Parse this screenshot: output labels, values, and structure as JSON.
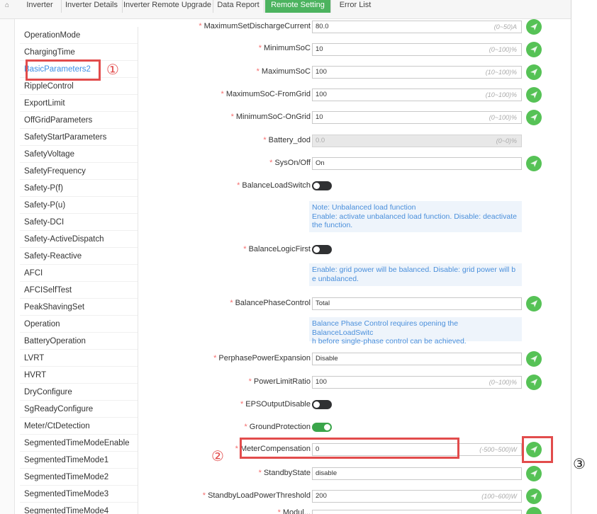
{
  "tabs": [
    "Inverter",
    "Inverter Details",
    "Inverter Remote Upgrade",
    "Data Report",
    "Remote Setting",
    "Error List"
  ],
  "sidebar": {
    "items": [
      "OperationMode",
      "ChargingTime",
      "BasicParameters2",
      "RippleControl",
      "ExportLimit",
      "OffGridParameters",
      "SafetyStartParameters",
      "SafetyVoltage",
      "SafetyFrequency",
      "Safety-P(f)",
      "Safety-P(u)",
      "Safety-DCI",
      "Safety-ActiveDispatch",
      "Safety-Reactive",
      "AFCI",
      "AFCISelfTest",
      "PeakShavingSet",
      "Operation",
      "BatteryOperation",
      "LVRT",
      "HVRT",
      "DryConfigure",
      "SgReadyConfigure",
      "Meter/CtDetection",
      "SegmentedTimeModeEnable",
      "SegmentedTimeMode1",
      "SegmentedTimeMode2",
      "SegmentedTimeMode3",
      "SegmentedTimeMode4"
    ],
    "active_item": "BasicParameters2"
  },
  "form": {
    "max_discharge": {
      "label": "MaximumSetDischargeCurrent",
      "value": "80.0",
      "unit": "(0~50)A"
    },
    "min_soc": {
      "label": "MinimumSoC",
      "value": "10",
      "unit": "(0~100)%"
    },
    "max_soc": {
      "label": "MaximumSoC",
      "value": "100",
      "unit": "(10~100)%"
    },
    "max_soc_grid": {
      "label": "MaximumSoC-FromGrid",
      "value": "100",
      "unit": "(10~100)%"
    },
    "min_soc_ongrid": {
      "label": "MinimumSoC-OnGrid",
      "value": "10",
      "unit": "(0~100)%"
    },
    "battery_dod": {
      "label": "Battery_dod",
      "value": "0.0",
      "unit": "(0~0)%"
    },
    "sys_onoff": {
      "label": "SysOn/Off",
      "value": "On"
    },
    "balance_load_switch": {
      "label": "BalanceLoadSwitch",
      "state": "off"
    },
    "note_balance_load": [
      "Note: Unbalanced load function",
      "Enable: activate unbalanced load function.  Disable: deactivate",
      "the function."
    ],
    "balance_logic_first": {
      "label": "BalanceLogicFirst",
      "state": "off"
    },
    "note_balance_logic": [
      "Enable: grid power will be balanced.  Disable: grid power will b",
      "e unbalanced."
    ],
    "balance_phase": {
      "label": "BalancePhaseControl",
      "value": "Total"
    },
    "note_balance_phase": [
      "Balance Phase Control requires opening the BalanceLoadSwitc",
      "h before single-phase control can be achieved."
    ],
    "perphase": {
      "label": "PerphasePowerExpansion",
      "value": "Disable"
    },
    "power_limit": {
      "label": "PowerLimitRatio",
      "value": "100",
      "unit": "(0~100)%"
    },
    "eps_output": {
      "label": "EPSOutputDisable",
      "state": "off"
    },
    "ground_protection": {
      "label": "GroundProtection",
      "state": "on"
    },
    "meter_comp": {
      "label": "MeterCompensation",
      "value": "0",
      "unit": "(-500~500)W"
    },
    "standby_state": {
      "label": "StandbyState",
      "value": "disable"
    },
    "standby_threshold": {
      "label": "StandbyLoadPowerThreshold",
      "value": "200",
      "unit": "(100~600)W"
    },
    "cut_label": "Modul..."
  },
  "annotations": {
    "one": "①",
    "two": "②",
    "three": "③"
  },
  "colors": {
    "accent_green": "#56c256",
    "annotation_red": "#e24c4c",
    "active_blue": "#3a8ee6",
    "note_bg": "#eef4fb"
  }
}
